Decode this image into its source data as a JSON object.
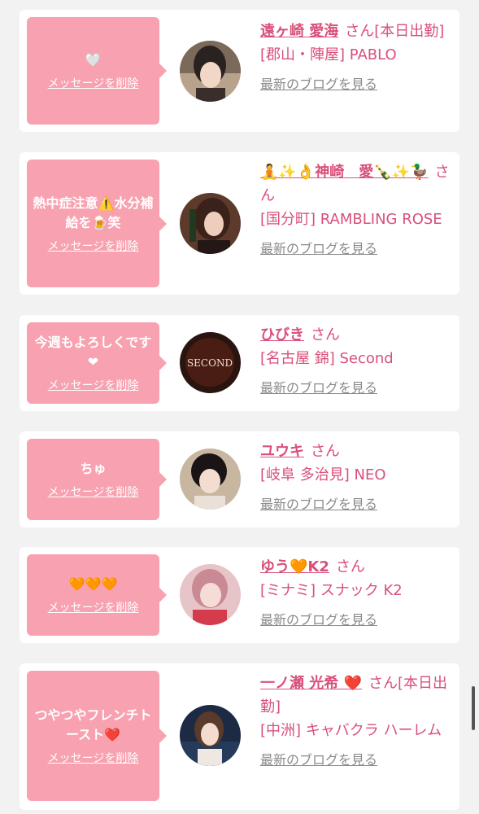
{
  "accent_color": "#f8a1b0",
  "name_color": "#d9507a",
  "entries": [
    {
      "message": "🤍",
      "delete_label": "メッセージを削除",
      "cast_name": "遠ヶ崎 愛海",
      "suffix": "さん[本日出勤]",
      "shop": "[郡山・陣屋] PABLO",
      "blog_link": "最新のブログを見る"
    },
    {
      "message": "熱中症注意⚠️水分補給を🍺笑",
      "delete_label": "メッセージを削除",
      "cast_name": "🧘✨👌神崎　愛🍾✨🦆",
      "suffix": "さん",
      "shop": "[国分町] RAMBLING ROSE",
      "blog_link": "最新のブログを見る"
    },
    {
      "message": "今週もよろしくです❤",
      "delete_label": "メッセージを削除",
      "cast_name": "ひびき",
      "suffix": "さん",
      "shop": "[名古屋 錦] Second",
      "blog_link": "最新のブログを見る",
      "avatar_text": "SECOND"
    },
    {
      "message": "ちゅ",
      "delete_label": "メッセージを削除",
      "cast_name": "ユウキ",
      "suffix": "さん",
      "shop": "[岐阜 多治見] NEO",
      "blog_link": "最新のブログを見る"
    },
    {
      "message": "🧡🧡🧡",
      "delete_label": "メッセージを削除",
      "cast_name": "ゆう🧡K2",
      "suffix": "さん",
      "shop": "[ミナミ] スナック K2",
      "blog_link": "最新のブログを見る"
    },
    {
      "message": "つやつやフレンチトースト❤️",
      "delete_label": "メッセージを削除",
      "cast_name": "一ノ瀬 光希 ❤️",
      "suffix": "さん[本日出勤]",
      "shop": "[中洲] キャバクラ ハーレム",
      "blog_link": "最新のブログを見る"
    }
  ]
}
